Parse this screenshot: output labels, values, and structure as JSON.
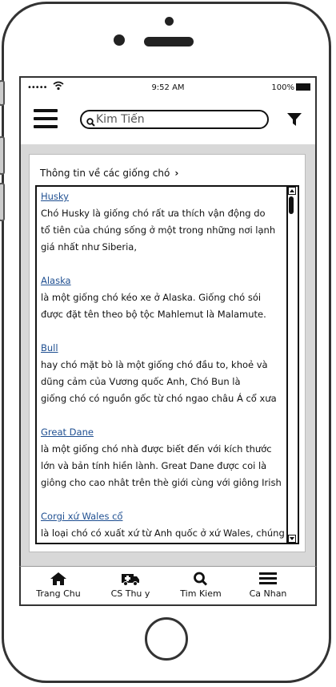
{
  "status_bar": {
    "signal": "•••••",
    "time": "9:52 AM",
    "battery": "100%"
  },
  "header": {
    "search_value": "Kim Tiến",
    "menu_icon": "hamburger-icon",
    "filter_icon": "filter-icon"
  },
  "breadcrumb": {
    "label": "Thông tin về các giống chó",
    "chevron": "›"
  },
  "entries": [
    {
      "title": "Husky",
      "lines": [
        "Chó Husky là giống chó rất ưa thích vận động do",
        "tổ tiên của chúng sống ở một trong những nơi lạnh",
        "giá nhất như Siberia,"
      ]
    },
    {
      "title": "Alaska",
      "lines": [
        "là một giống chó kéo xe ở Alaska. Giống chó sói",
        "được đặt tên theo bộ tộc Mahlemut là Malamute."
      ]
    },
    {
      "title": "Bull",
      "lines": [
        "hay chó mặt bò là một giống chó đầu to, khoẻ và",
        "dũng cảm của Vương quốc Anh, Chó Bun là",
        "giống chó có nguồn gốc từ chó ngao châu Á cổ xưa"
      ]
    },
    {
      "title": "Great Dane",
      "lines": [
        "là một giống chó nhà được biết đến với kích thước",
        "lớn và bản tính hiền lành. Great Dane được coi là",
        "giông cho cao nhât trên thè giới cùng với giông Irish"
      ]
    },
    {
      "title": "Corgi xứ Wales cổ",
      "lines": [
        "là loại chó có xuất xứ từ Anh quốc ở xứ Wales, chúng"
      ]
    }
  ],
  "tabs": [
    {
      "label": "Trang Chu",
      "icon": "home-icon"
    },
    {
      "label": "CS Thu y",
      "icon": "ambulance-icon"
    },
    {
      "label": "Tim Kiem",
      "icon": "search-icon"
    },
    {
      "label": "Ca Nhan",
      "icon": "menu-bars-icon"
    }
  ]
}
